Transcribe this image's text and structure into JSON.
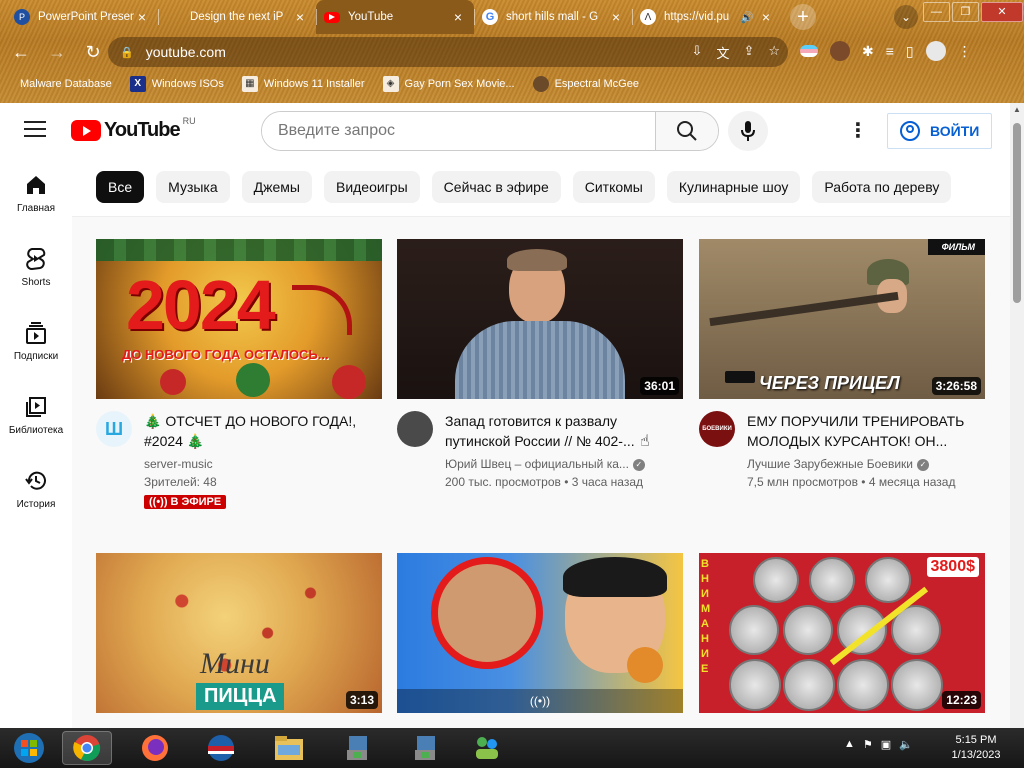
{
  "browser": {
    "tabs": [
      {
        "label": "PowerPoint Presen",
        "icon": "powerpoint-icon"
      },
      {
        "label": "Design the next iP",
        "icon": "apple-icon"
      },
      {
        "label": "YouTube",
        "icon": "youtube-icon",
        "active": true
      },
      {
        "label": "short hills mall - G",
        "icon": "google-icon"
      },
      {
        "label": "https://vid.pu",
        "icon": "site-icon"
      }
    ],
    "url": "youtube.com",
    "bookmarks": [
      {
        "label": "Malware Database"
      },
      {
        "label": "Windows ISOs"
      },
      {
        "label": "Windows 11 Installer"
      },
      {
        "label": "Gay Porn Sex Movie..."
      },
      {
        "label": "Espectral McGee"
      }
    ]
  },
  "youtube": {
    "logo_text": "YouTube",
    "country_code": "RU",
    "search_placeholder": "Введите запрос",
    "signin_label": "ВОЙТИ",
    "chips": [
      "Все",
      "Музыка",
      "Джемы",
      "Видеоигры",
      "Сейчас в эфире",
      "Ситкомы",
      "Кулинарные шоу",
      "Работа по дереву"
    ],
    "rail": [
      {
        "label": "Главная",
        "icon": "home-icon"
      },
      {
        "label": "Shorts",
        "icon": "shorts-icon"
      },
      {
        "label": "Подписки",
        "icon": "subscriptions-icon"
      },
      {
        "label": "Библиотека",
        "icon": "library-icon"
      },
      {
        "label": "История",
        "icon": "history-icon"
      }
    ],
    "videos": [
      {
        "thumb_text": "2024",
        "thumb_sub": "ДО НОВОГО ГОДА ОСТАЛОСЬ...",
        "title": "🎄 ОТСЧЕТ ДО НОВОГО ГОДА!, #2024 🎄",
        "channel": "server-music",
        "stats": "Зрителей: 48",
        "live_label": "((•)) В ЭФИРЕ"
      },
      {
        "duration": "36:01",
        "title": "Запад готовится к развалу путинской России // № 402-...",
        "channel": "Юрий Швец – официальный ка...",
        "stats": "200 тыс. просмотров • 3 часа назад"
      },
      {
        "duration": "3:26:58",
        "thumb_badge": "ФИЛЬМ",
        "thumb_text": "ЧЕРЕЗ ПРИЦЕЛ",
        "title": "ЕМУ ПОРУЧИЛИ ТРЕНИРОВАТЬ МОЛОДЫХ КУРСАНТОК! ОН...",
        "channel": "Лучшие Зарубежные Боевики",
        "stats": "7,5 млн просмотров • 4 месяца назад",
        "avatar_text": "БОЕВИКИ"
      },
      {
        "duration": "3:13",
        "thumb_text_top": "Мини",
        "thumb_text_bottom": "ПИЦЦА"
      },
      {
        "live_icon": "((•))"
      },
      {
        "duration": "12:23",
        "thumb_badge": "3800$",
        "thumb_side": "ВНИМАНИЕ"
      }
    ]
  },
  "taskbar": {
    "time": "5:15 PM",
    "date": "1/13/2023"
  }
}
